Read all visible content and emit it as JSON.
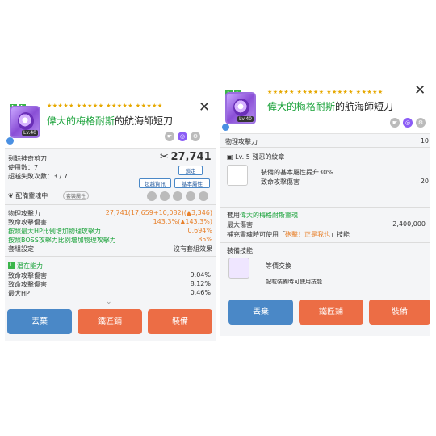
{
  "item": {
    "stars": "★★★★★ ★★★★★ ★★★★★ ★★★★★",
    "name_green": "偉大的梅格耐斯",
    "name_rest": "的航海師短刀",
    "level": "Lv.40",
    "ll": [
      "L",
      "L"
    ]
  },
  "left": {
    "scissors_label": "剩餘神奇剪刀",
    "used_label": "使用數：7",
    "fail_label": "超越失敗次數：3 / 7",
    "power_icon": "✂",
    "power_value": "27,741",
    "btn_fixed": "鎖定",
    "btn_transcend": "超越資訊",
    "btn_basic": "基本屬性",
    "soul_label": "配備靈魂中",
    "soul_tag": "套裝屬性",
    "stats": [
      {
        "label": "物理攻擊力",
        "value": "27,741(17,659+10,082)(▲3,346)"
      },
      {
        "label": "致命攻擊傷害",
        "value": "143.3%(▲143.3%)"
      },
      {
        "label": "按照最大HP比例增加物理攻擊力",
        "value": "0.694%"
      },
      {
        "label": "按照BOSS攻擊力比例增加物理攻擊力",
        "value": "85%"
      },
      {
        "label": "套組設定",
        "value": "沒有套組效果"
      }
    ],
    "potential_title": "潛在能力",
    "potential": [
      {
        "label": "致命攻擊傷害",
        "value": "9.04%"
      },
      {
        "label": "致命攻擊傷害",
        "value": "8.12%"
      },
      {
        "label": "最大HP",
        "value": "0.46%"
      }
    ],
    "buttons": [
      "丟棄",
      "鐵匠鋪",
      "裝備"
    ]
  },
  "right": {
    "cut_label": "物理攻擊力",
    "cut_value": "10",
    "emblem_title": "Lv. 5 殘忍的紋章",
    "emblem_desc": "裝備的基本屬性提升30%",
    "emblem_stat": "致命攻擊傷害",
    "emblem_value": "20",
    "soul_line_prefix": "套用",
    "soul_line_green": "偉大的梅格耐斯靈魂",
    "maxhp_label": "最大傷害",
    "maxhp_value": "2,400,000",
    "recharge_label": "補充靈魂時可使用「",
    "recharge_red": "砲擊！正是我也",
    "recharge_suffix": "」技能",
    "equip_skill_title": "裝備技能",
    "skill_name": "等價交換",
    "skill_desc": "配載裝備時可使用技能",
    "buttons": [
      "丟棄",
      "鐵匠鋪",
      "裝備"
    ]
  },
  "colors": {
    "blue_button": "#4a88c7",
    "orange_button": "#ec6d45",
    "green_text": "#1aa23a",
    "orange_text": "#e8802a"
  }
}
